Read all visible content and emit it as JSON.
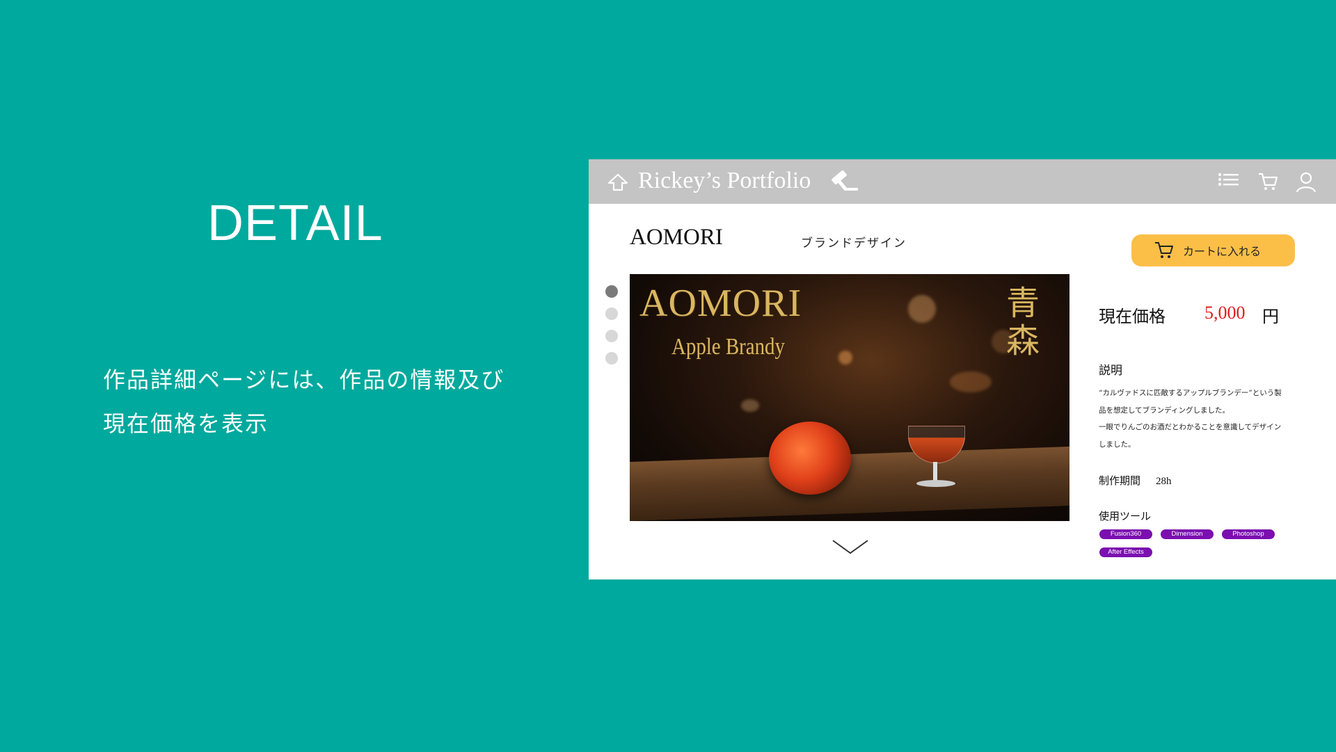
{
  "slide": {
    "title": "DETAIL",
    "description_lines": [
      "作品詳細ページには、作品の情報及び",
      "現在価格を表示"
    ]
  },
  "header": {
    "site_name": "Rickey’s Portfolio",
    "icons": [
      "home-icon",
      "gavel-icon",
      "menu-list-icon",
      "cart-icon",
      "user-icon"
    ]
  },
  "work": {
    "title": "AOMORI",
    "category": "ブランドデザイン"
  },
  "cart_button": {
    "label": "カートに入れる",
    "icon": "cart-icon"
  },
  "hero_image": {
    "title": "AOMORI",
    "subtitle": "Apple Brandy",
    "jp_title": "青森"
  },
  "carousel": {
    "slide_count": 4,
    "active_index": 0
  },
  "price": {
    "label": "現在価格",
    "value": "5,000",
    "unit": "円"
  },
  "description": {
    "heading": "説明",
    "lines": [
      "“カルヴァドスに匹敵するアップルブランデー”という製",
      "品を想定してブランディングしました。",
      "一眼でりんごのお酒だとわかることを意識してデザイン",
      "しました。"
    ]
  },
  "period": {
    "label": "制作期間",
    "value": "28h"
  },
  "tools": {
    "heading": "使用ツール",
    "items": [
      "Fusion360",
      "Dimension",
      "Photoshop",
      "After Effects"
    ]
  },
  "colors": {
    "background": "#00a99d",
    "header_bar": "#c4c4c4",
    "cart_button": "#fbbf48",
    "price": "#e31b1b",
    "tag": "#7b0fb0"
  }
}
